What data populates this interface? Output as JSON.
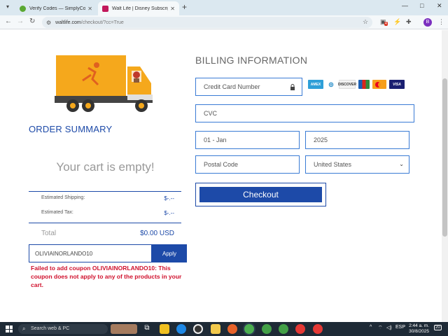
{
  "browser": {
    "tabs": [
      {
        "title": "Verify Codes — SimplyCodes",
        "active": false,
        "favicon_color": "#5aa832"
      },
      {
        "title": "Walt Life | Disney Subscription",
        "active": true,
        "favicon_color": "#c2185b"
      }
    ],
    "new_tab": "+",
    "window_controls": {
      "minimize": "—",
      "maximize": "□",
      "close": "✕"
    },
    "url": {
      "domain": "waltlife.com",
      "path": "/checkout/?cc=True"
    },
    "profile_initial": "B",
    "extension_badge": "4"
  },
  "order_summary": {
    "title": "ORDER SUMMARY",
    "empty_message": "Your cart is empty!",
    "shipping_label": "Estimated Shipping:",
    "shipping_value": "$-.--",
    "tax_label": "Estimated Tax:",
    "tax_value": "$-.--",
    "total_label": "Total",
    "total_value": "$0.00 USD"
  },
  "coupon": {
    "value": "OLIVIAINORLANDO10",
    "apply_label": "Apply",
    "error": "Failed to add coupon OLIVIAINORLANDO10: This coupon does not apply to any of the products in your cart."
  },
  "billing": {
    "title": "BILLING INFORMATION",
    "card_number_placeholder": "Credit Card Number",
    "cvc_placeholder": "CVC",
    "month_value": "01 - Jan",
    "year_value": "2025",
    "postal_placeholder": "Postal Code",
    "country_value": "United States",
    "checkout_label": "Checkout",
    "card_brands": [
      {
        "name": "AMEX",
        "color": "#2e9fd8"
      },
      {
        "name": "DINERS",
        "color": "#0079be"
      },
      {
        "name": "DISCOVER",
        "color": "#f2f2f2"
      },
      {
        "name": "JCB",
        "color": "#d9261c"
      },
      {
        "name": "MASTERCARD",
        "color": "#f79e1b"
      },
      {
        "name": "VISA",
        "color": "#1a1f71"
      }
    ]
  },
  "taskbar": {
    "search_placeholder": "Search web & PC",
    "language": "ESP",
    "time": "2:44 a. m.",
    "date": "30/8/2025",
    "notification_count": "20"
  }
}
